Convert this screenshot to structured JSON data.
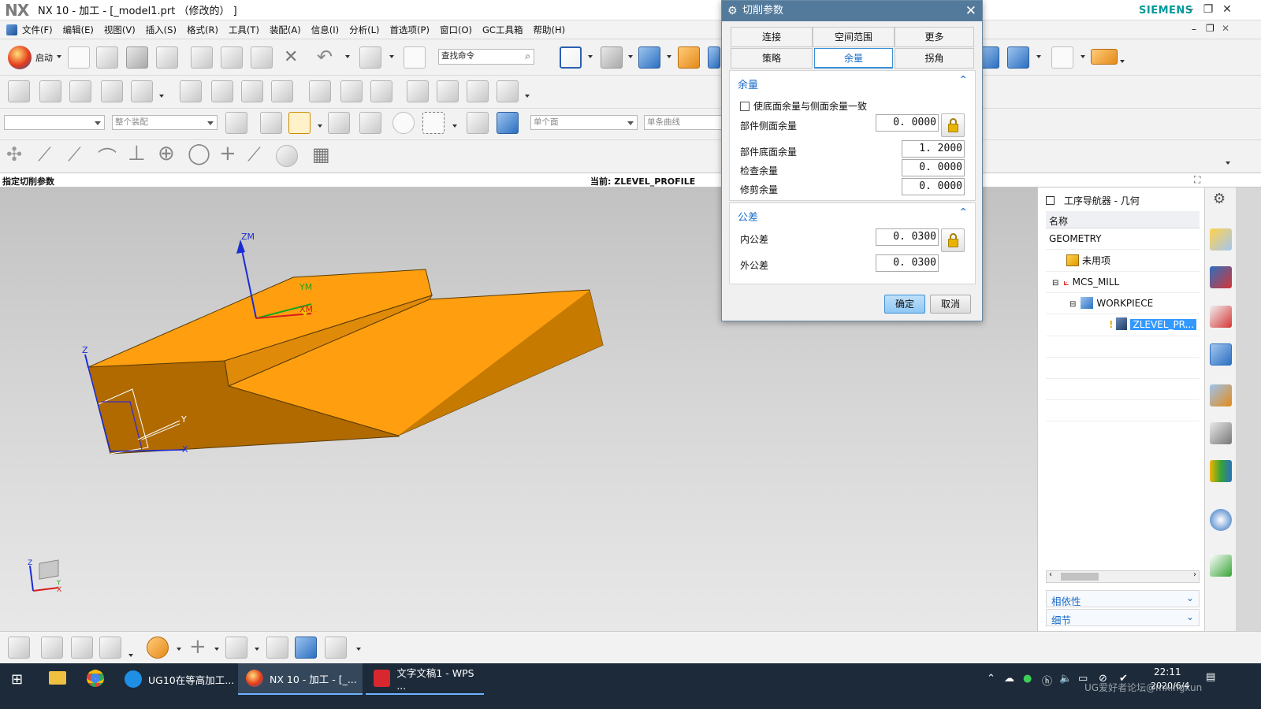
{
  "window": {
    "logo": "NX",
    "title": "NX 10 - 加工 - [_model1.prt （修改的） ]",
    "brand": "SIEMENS"
  },
  "menu": [
    "文件(F)",
    "编辑(E)",
    "视图(V)",
    "插入(S)",
    "格式(R)",
    "工具(T)",
    "装配(A)",
    "信息(I)",
    "分析(L)",
    "首选项(P)",
    "窗口(O)",
    "GC工具箱",
    "帮助(H)"
  ],
  "toolbar": {
    "start_label": "启动",
    "search_placeholder": "查找命令",
    "filter_combo_1": "",
    "filter_combo_2": "整个装配",
    "face_combo": "单个面",
    "curve_combo": "单条曲线"
  },
  "status": {
    "prompt": "指定切削参数",
    "current": "当前:  ZLEVEL_PROFILE"
  },
  "viewport": {
    "axis_zm": "ZM",
    "axis_ym": "YM",
    "axis_xm": "XM",
    "axis_z": "Z",
    "axis_y": "Y",
    "axis_x": "X",
    "triad_z": "Z",
    "triad_y": "Y",
    "triad_x": "X"
  },
  "dialog": {
    "title": "切削参数",
    "tabs_row1": [
      "连接",
      "空间范围",
      "更多"
    ],
    "tabs_row2": [
      "策略",
      "余量",
      "拐角"
    ],
    "active_tab": "余量",
    "stock_group": {
      "heading": "余量",
      "checkbox_label": "使底面余量与侧面余量一致",
      "checkbox_checked": false,
      "part_side_label": "部件侧面余量",
      "part_side_value": "0. 0000",
      "part_floor_label": "部件底面余量",
      "part_floor_value": "1. 2000",
      "check_label": "检查余量",
      "check_value": "0. 0000",
      "trim_label": "修剪余量",
      "trim_value": "0. 0000"
    },
    "tolerance_group": {
      "heading": "公差",
      "intol_label": "内公差",
      "intol_value": "0. 0300",
      "outtol_label": "外公差",
      "outtol_value": "0. 0300"
    },
    "ok_label": "确定",
    "cancel_label": "取消"
  },
  "navigator": {
    "title": "工序导航器 - 几何",
    "column_name": "名称",
    "rows": [
      "GEOMETRY",
      "未用项",
      "MCS_MILL",
      "WORKPIECE",
      "ZLEVEL_PR..."
    ],
    "section_dependencies": "相依性",
    "section_details": "细节"
  },
  "taskbar": {
    "items": [
      "UG10在等高加工...",
      "NX 10 - 加工 - [_...",
      "文字文稿1 - WPS ..."
    ],
    "time": "22:11",
    "date": "2020/6/4",
    "watermark": "UG爱好者论坛@mxingkun"
  },
  "colors": {
    "dialog_title_bg": "#537a9b",
    "accent_blue": "#1a6cc7",
    "part_top": "#ff9f10",
    "part_side": "#b06a00",
    "selected_row": "#3399ff",
    "taskbar_bg": "#1c2a3a"
  }
}
